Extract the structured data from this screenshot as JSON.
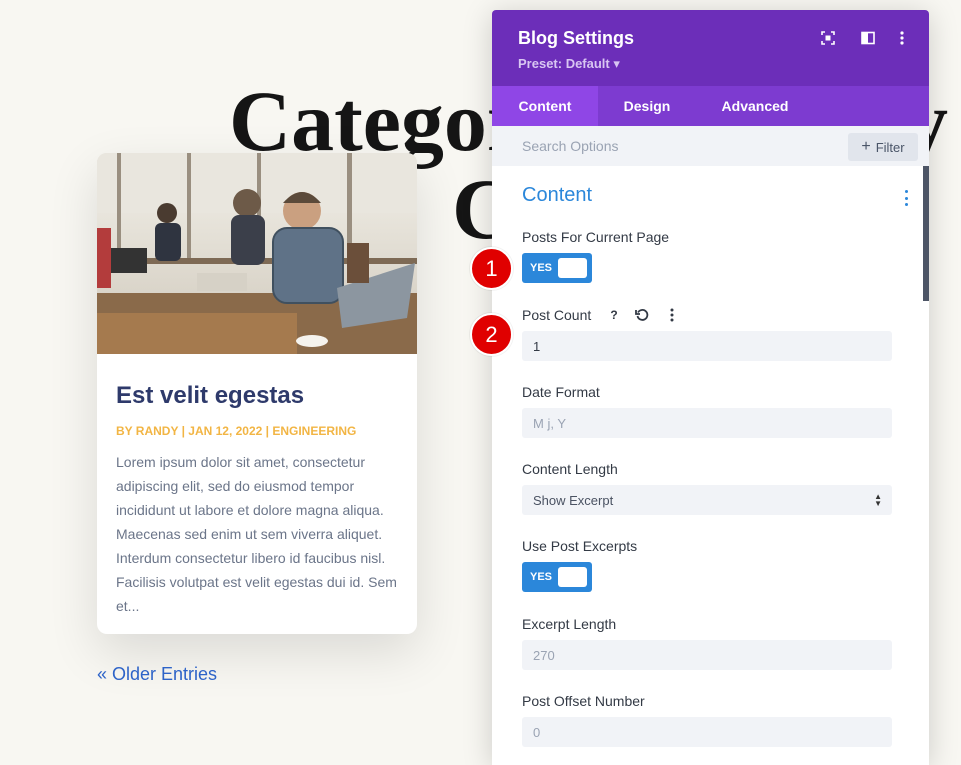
{
  "background": {
    "hero_line1_left": "Categor",
    "hero_line1_right": "y",
    "hero_line2": "C",
    "post": {
      "title": "Est velit egestas",
      "meta": "BY RANDY | JAN 12, 2022 | ENGINEERING",
      "excerpt": "Lorem ipsum dolor sit amet, consectetur adipiscing elit, sed do eiusmod tempor incididunt ut labore et dolore magna aliqua. Maecenas sed enim ut sem viverra aliquet. Interdum consectetur libero id faucibus nisl. Facilisis volutpat est velit egestas dui id. Sem et..."
    },
    "older_entries": "« Older Entries"
  },
  "panel": {
    "title": "Blog Settings",
    "preset": "Preset: Default ▾",
    "tabs": [
      {
        "label": "Content",
        "active": true
      },
      {
        "label": "Design",
        "active": false
      },
      {
        "label": "Advanced",
        "active": false
      }
    ],
    "search_placeholder": "Search Options",
    "filter_label": "Filter",
    "section_title": "Content",
    "fields": {
      "posts_for_current_page": {
        "label": "Posts For Current Page",
        "toggle": "YES"
      },
      "post_count": {
        "label": "Post Count",
        "value": "1"
      },
      "date_format": {
        "label": "Date Format",
        "placeholder": "M j, Y"
      },
      "content_length": {
        "label": "Content Length",
        "value": "Show Excerpt"
      },
      "use_post_excerpts": {
        "label": "Use Post Excerpts",
        "toggle": "YES"
      },
      "excerpt_length": {
        "label": "Excerpt Length",
        "placeholder": "270"
      },
      "post_offset_number": {
        "label": "Post Offset Number",
        "placeholder": "0"
      }
    }
  },
  "annotations": {
    "badge1": "1",
    "badge2": "2"
  },
  "colors": {
    "panel_header": "#6c2eb9",
    "tabs_bar": "#7d3bd0",
    "accent_blue": "#2b87da",
    "badge_red": "#e00000"
  }
}
